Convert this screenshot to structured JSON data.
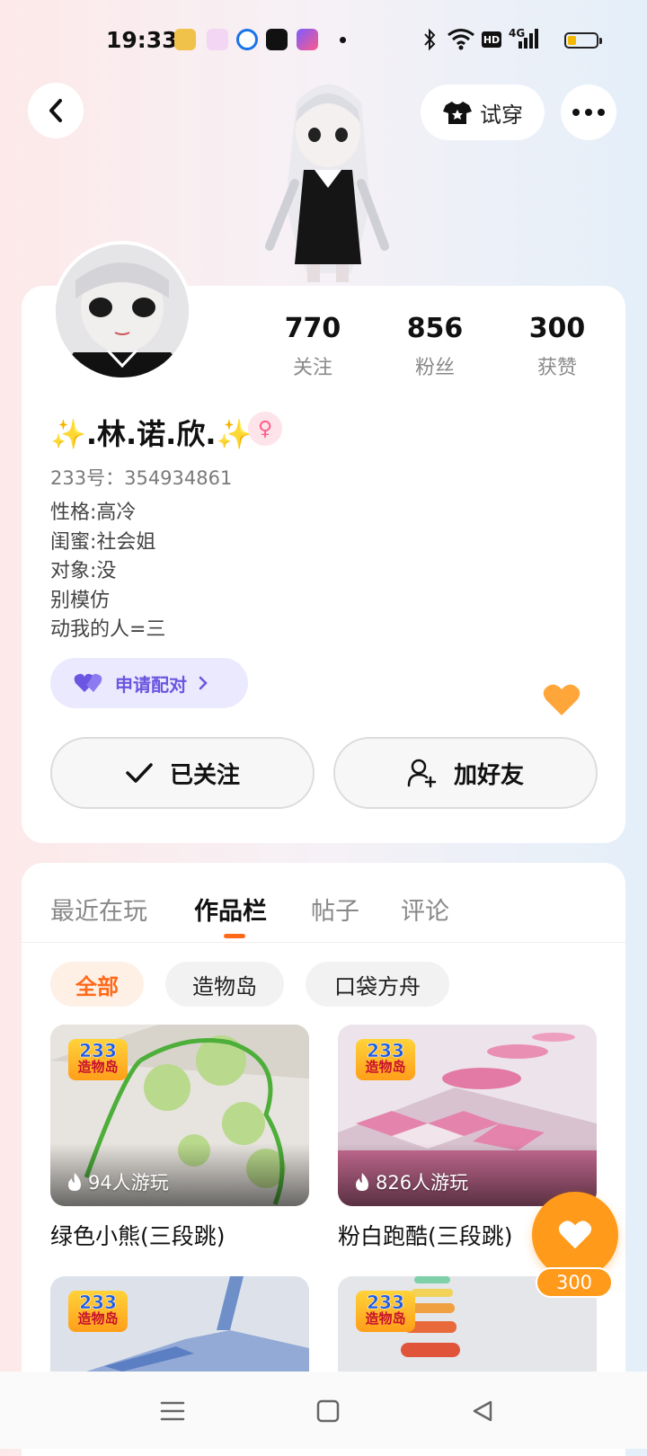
{
  "status_bar": {
    "time": "19:33",
    "network": "4G",
    "hd": "HD"
  },
  "header": {
    "try_on_label": "试穿"
  },
  "profile": {
    "stats": [
      {
        "value": "770",
        "label": "关注"
      },
      {
        "value": "856",
        "label": "粉丝"
      },
      {
        "value": "300",
        "label": "获赞"
      }
    ],
    "name": "✨.林.诺.欣.✨",
    "gender_symbol": "♀",
    "id_label": "233号：",
    "id_value": "354934861",
    "bio": [
      "性格:高冷",
      "闺蜜:社会姐",
      "对象:没",
      "别模仿",
      "动我的人=三"
    ],
    "pair_label": "申请配对",
    "follow_label": "已关注",
    "add_friend_label": "加好友"
  },
  "tabs": [
    {
      "label": "最近在玩",
      "active": false
    },
    {
      "label": "作品栏",
      "active": true
    },
    {
      "label": "帖子",
      "active": false
    },
    {
      "label": "评论",
      "active": false
    }
  ],
  "filters": [
    {
      "label": "全部",
      "active": true
    },
    {
      "label": "造物岛",
      "active": false
    },
    {
      "label": "口袋方舟",
      "active": false
    }
  ],
  "badge": {
    "top": "233",
    "bottom": "造物岛"
  },
  "games": [
    {
      "title": "绿色小熊(三段跳)",
      "plays": "94人游玩"
    },
    {
      "title": "粉白跑酷(三段跳)",
      "plays": "826人游玩"
    },
    {
      "title": "",
      "plays": ""
    },
    {
      "title": "",
      "plays": ""
    }
  ],
  "floating_like": {
    "count": "300"
  },
  "colors": {
    "accent": "#ff6a1a",
    "like": "#ff9a1a",
    "pair": "#6a56e0"
  }
}
